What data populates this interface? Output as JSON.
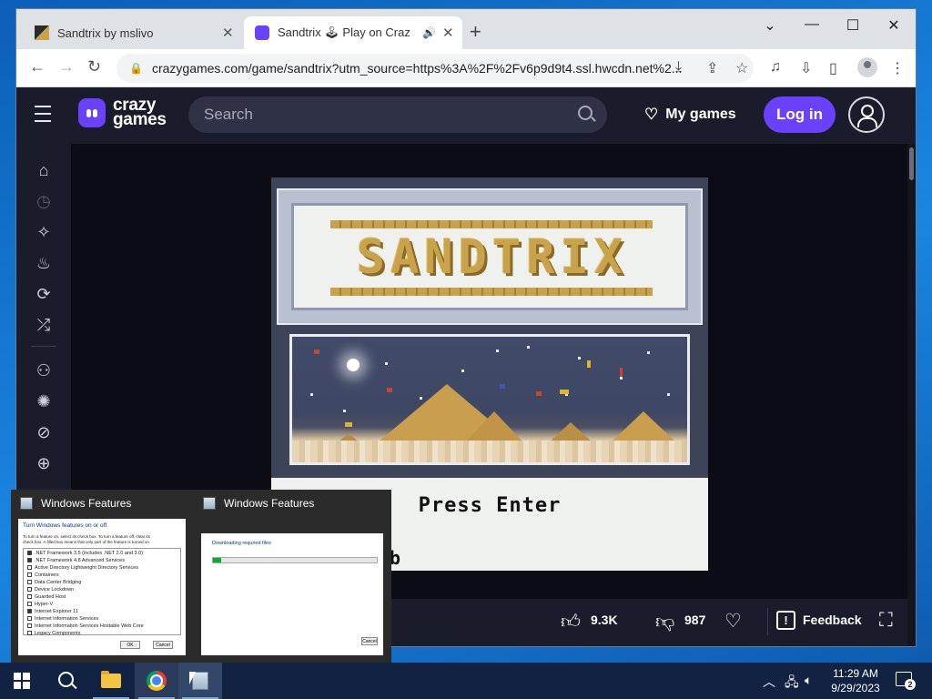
{
  "browser": {
    "tabs": [
      {
        "title": "Sandtrix by mslivo",
        "close": "✕"
      },
      {
        "title": "Sandtrix 🕹 Play on CrazyGa",
        "close": "✕",
        "audio": "🔊"
      }
    ],
    "new_tab": "+",
    "window_controls": {
      "tabsearch": "⌄",
      "minimize": "—",
      "maximize": "☐",
      "close": "✕"
    },
    "url": "crazygames.com/game/sandtrix?utm_source=https%3A%2F%2Fv6p9d9t4.ssl.hwcdn.net%2..."
  },
  "site": {
    "logo_line1": "crazy",
    "logo_line2": "games",
    "search_placeholder": "Search",
    "my_games": "My games",
    "login": "Log in"
  },
  "game": {
    "title_word": "SANDTRIX",
    "press_enter": "Press Enter",
    "partial_text": "b"
  },
  "game_bar": {
    "likes": "9.3K",
    "dislikes": "987",
    "feedback": "Feedback"
  },
  "preview": {
    "window1_title": "Windows Features",
    "window2_title": "Windows Features",
    "dialog_heading": "Turn Windows features on or off",
    "dialog_desc_1": "To turn a feature on, select its check box. To turn a feature off, clear its",
    "dialog_desc_2": "check box. A filled box means that only part of the feature is turned on.",
    "features": [
      ".NET Framework 3.5 (includes .NET 2.0 and 3.0)",
      ".NET Framework 4.8 Advanced Services",
      "Active Directory Lightweight Directory Services",
      "Containers",
      "Data Center Bridging",
      "Device Lockdown",
      "Guarded Host",
      "Hyper-V",
      "Internet Explorer 11",
      "Internet Information Services",
      "Internet Information Services Hostable Web Core",
      "Legacy Components"
    ],
    "ok": "OK",
    "cancel": "Cancel",
    "downloading": "Downloading required files",
    "cancel2": "Cancel",
    "progress": 0.05
  },
  "taskbar": {
    "time": "11:29 AM",
    "date": "9/29/2023",
    "notification_count": "2"
  },
  "colors": {
    "accent": "#6842ff",
    "header_bg": "#1b1c2b",
    "sand_gold": "#c9a24c"
  }
}
